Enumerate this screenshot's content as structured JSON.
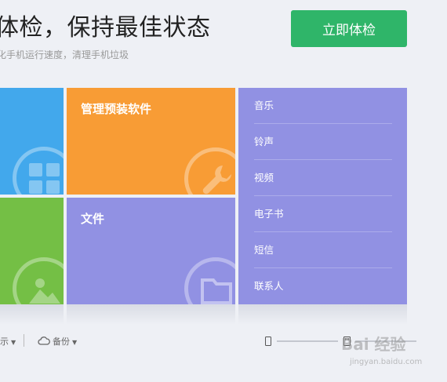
{
  "header": {
    "headline": "体检，保持最佳状态",
    "subline": "化手机运行速度，清理手机垃圾",
    "checkup_button": "立即体检"
  },
  "tiles": {
    "apps_label": "管理预装软件",
    "files_label": "文件"
  },
  "media_list": {
    "items": [
      "音乐",
      "铃声",
      "视频",
      "电子书",
      "短信",
      "联系人"
    ]
  },
  "bottom_bar": {
    "display_label": "示",
    "backup_label": "备份"
  },
  "watermark": {
    "text": "Bai 经验",
    "url": "jingyan.baidu.com"
  },
  "colors": {
    "blue_tile": "#42a8ec",
    "orange_tile": "#f89c35",
    "green_tile": "#74bf45",
    "purple_tile": "#9191e3",
    "checkup_button": "#2fb569"
  },
  "icons": {
    "apps_tile": "grid-icon",
    "tools_tile": "wrench-icon",
    "photos_tile": "image-icon",
    "files_tile": "folder-icon",
    "backup": "cloud-icon",
    "phone": "phone-icon",
    "storage": "sd-card-icon"
  }
}
